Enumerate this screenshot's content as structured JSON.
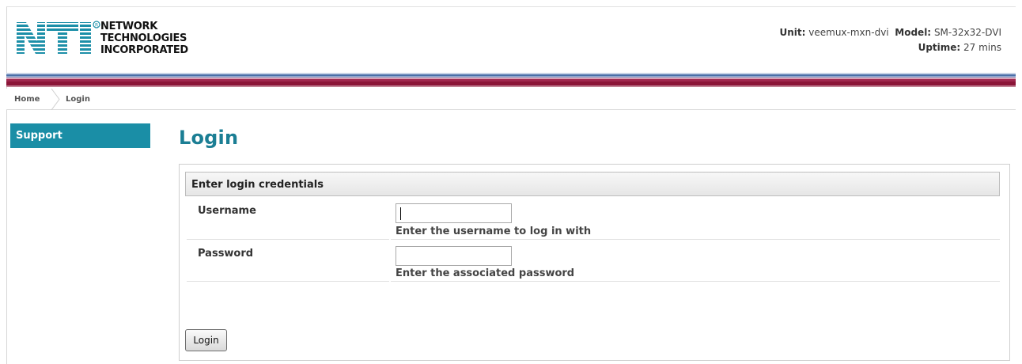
{
  "header": {
    "logo_lines": [
      "NETWORK",
      "TECHNOLOGIES",
      "INCORPORATED"
    ],
    "unit_label": "Unit:",
    "unit_value": "veemux-mxn-dvi",
    "model_label": "Model:",
    "model_value": "SM-32x32-DVI",
    "uptime_label": "Uptime:",
    "uptime_value": "27 mins"
  },
  "breadcrumb": {
    "home": "Home",
    "current": "Login"
  },
  "sidebar": {
    "items": [
      {
        "label": "Support"
      }
    ]
  },
  "main": {
    "title": "Login",
    "panel_heading": "Enter login credentials",
    "username_label": "Username",
    "username_value": "",
    "username_hint": "Enter the username to log in with",
    "password_label": "Password",
    "password_value": "",
    "password_hint": "Enter the associated password",
    "login_button": "Login"
  },
  "colors": {
    "accent": "#1a8ea6",
    "title": "#1b7e94",
    "stripe_red": "#8b1538",
    "stripe_blue": "#4b6fa8"
  },
  "icons": {
    "logo": "nti-logo-icon",
    "breadcrumb_separator": "chevron-right-icon"
  }
}
